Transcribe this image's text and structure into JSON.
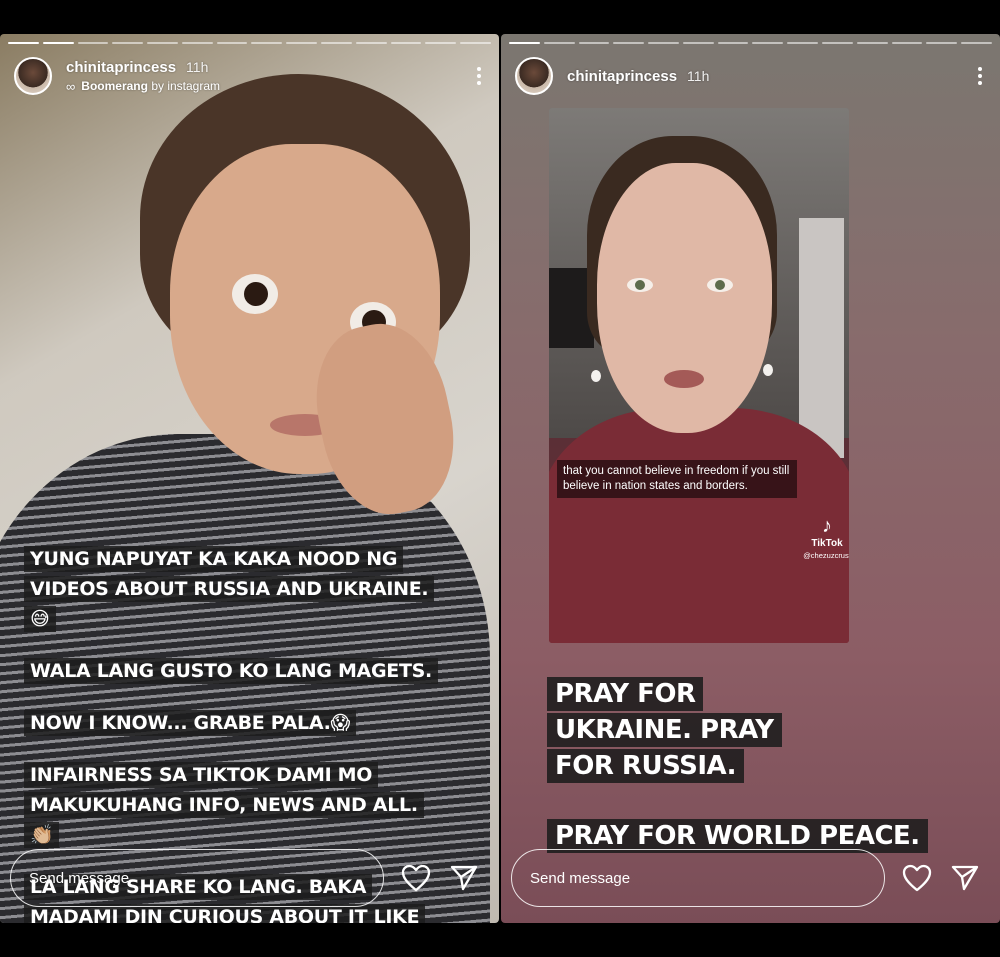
{
  "stories": [
    {
      "username": "chinitaprincess",
      "time": "11h",
      "effect_name": "Boomerang",
      "effect_by": "by instagram",
      "caption_lines": [
        "YUNG NAPUYAT KA KAKA NOOD NG VIDEOS ABOUT RUSSIA AND UKRAINE.😅",
        "WALA LANG GUSTO KO LANG MAGETS.",
        "NOW I KNOW... GRABE PALA.😱",
        "INFAIRNESS SA TIKTOK DAMI MO MAKUKUHANG INFO, NEWS AND ALL. 👏🏼",
        "LA LANG SHARE KO LANG. BAKA MADAMI DIN CURIOUS ABOUT IT LIKE ME.😅"
      ],
      "send_placeholder": "Send message"
    },
    {
      "username": "chinitaprincess",
      "time": "11h",
      "video": {
        "subtitle": "that you cannot believe in freedom if you still believe in nation states and borders.",
        "tiktok_label": "TikTok",
        "tiktok_handle": "@chezuzcrust"
      },
      "caption_lines": [
        "PRAY FOR UKRAINE. PRAY FOR RUSSIA.",
        "PRAY FOR WORLD PEACE."
      ],
      "send_placeholder": "Send message"
    }
  ],
  "icons": {
    "more": "more-vertical-icon",
    "like": "heart-icon",
    "share": "paper-plane-icon",
    "boomerang": "infinity-icon",
    "tiktok": "tiktok-logo-icon"
  },
  "colors": {
    "caption_bg": "#1c1c1c",
    "right_bg": "#8c5d65"
  }
}
